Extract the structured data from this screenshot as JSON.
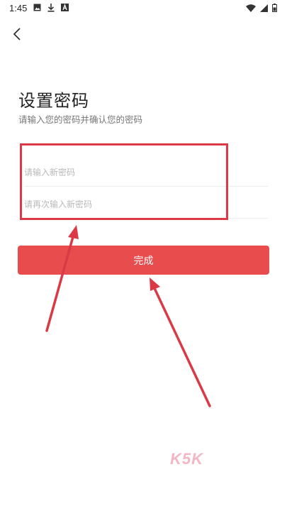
{
  "status_bar": {
    "time": "1:45",
    "left_icons": [
      "image-icon",
      "download-icon",
      "a-icon"
    ],
    "right_icons": [
      "wifi-icon",
      "signal-icon",
      "battery-icon"
    ]
  },
  "nav": {
    "back_icon": "chevron-left-icon"
  },
  "page": {
    "title": "设置密码",
    "subtitle": "请输入您的密码并确认您的密码"
  },
  "form": {
    "new_password_placeholder": "请输入新密码",
    "confirm_password_placeholder": "请再次输入新密码",
    "new_password_value": "",
    "confirm_password_value": "",
    "submit_label": "完成",
    "submit_color": "#e84c4c"
  },
  "annotations": {
    "highlight_color": "#d93a45"
  },
  "watermark": {
    "text": "K5K"
  }
}
